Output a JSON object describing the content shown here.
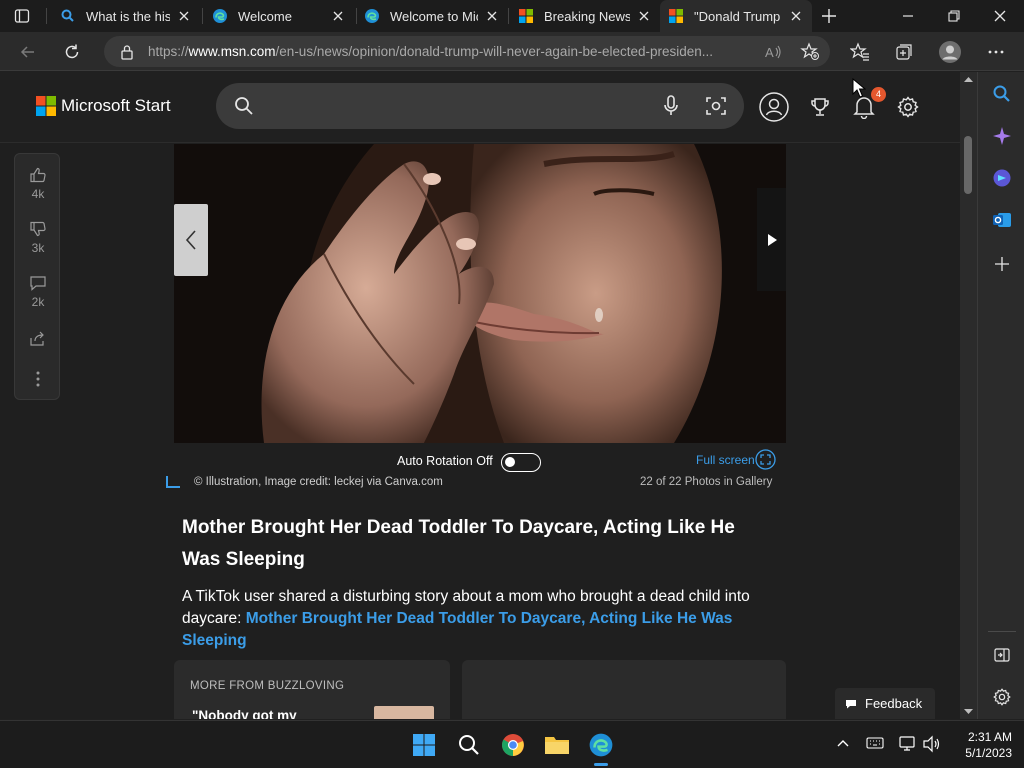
{
  "tabs": [
    {
      "title": "What is the histo",
      "icon": "search-icon"
    },
    {
      "title": "Welcome",
      "icon": "edge-icon"
    },
    {
      "title": "Welcome to Mic",
      "icon": "edge-icon"
    },
    {
      "title": "Breaking News S",
      "icon": "microsoft-icon"
    },
    {
      "title": "\"Donald Trump",
      "icon": "microsoft-icon",
      "active": true
    }
  ],
  "address": {
    "url_prefix": "https://",
    "url_domain": "www.msn.com",
    "url_path": "/en-us/news/opinion/donald-trump-will-never-again-be-elected-presiden..."
  },
  "msn": {
    "brand": "Microsoft Start",
    "notifications_count": "4"
  },
  "rail": {
    "likes": "4k",
    "dislikes": "3k",
    "comments": "2k"
  },
  "gallery": {
    "auto_rotation": "Auto Rotation Off",
    "full_screen": "Full screen",
    "credit": "© Illustration, Image credit: leckej via Canva.com",
    "count": "22 of 22 Photos in Gallery"
  },
  "article": {
    "headline": "Mother Brought Her Dead Toddler To Daycare, Acting Like He Was Sleeping",
    "summary_text": "A TikTok user shared a disturbing story about a mom who brought a dead child into daycare: ",
    "summary_link": "Mother Brought Her Dead Toddler To Daycare, Acting Like He Was Sleeping"
  },
  "more": {
    "header": "MORE FROM BUZZLOVING",
    "title": "\"Nobody got my"
  },
  "feedback": "Feedback",
  "taskbar": {
    "time": "2:31 AM",
    "date": "5/1/2023"
  },
  "colors": {
    "accent": "#3b9de8",
    "badge": "#e4572e"
  }
}
